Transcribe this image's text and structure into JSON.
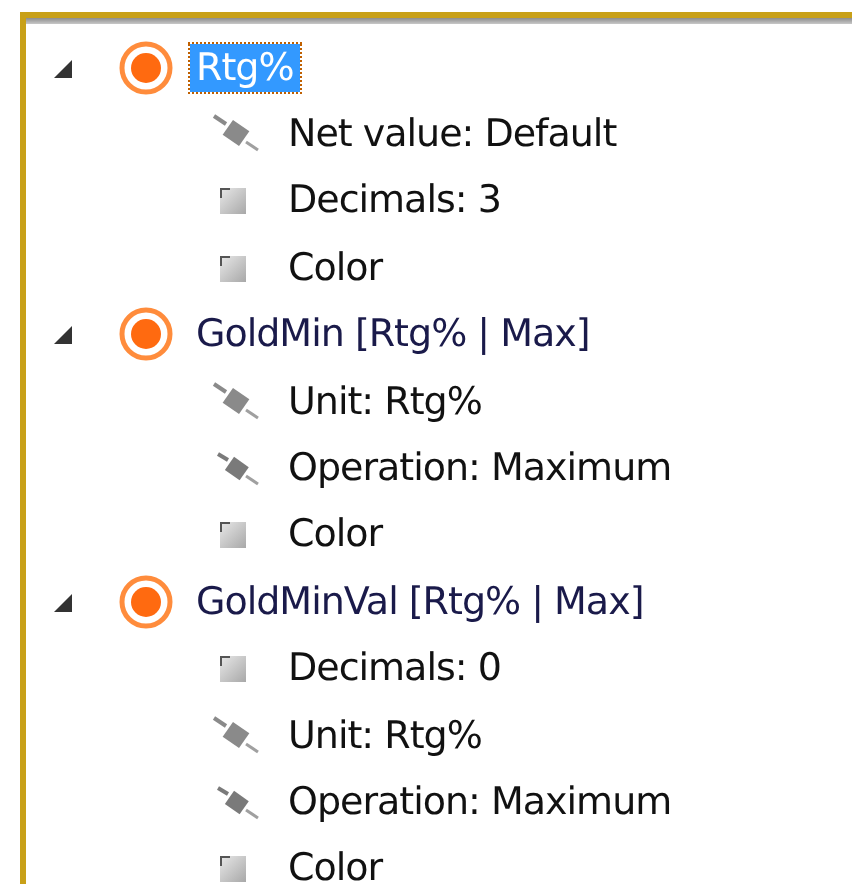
{
  "tree": [
    {
      "label": "Rtg%",
      "selected": true,
      "expanded": true,
      "children": [
        {
          "label": "Net value: Default",
          "kind": "link"
        },
        {
          "label": "Decimals: 3",
          "kind": "setting"
        },
        {
          "label": "Color",
          "kind": "setting"
        }
      ]
    },
    {
      "label": "GoldMin [Rtg% | Max]",
      "selected": false,
      "expanded": true,
      "children": [
        {
          "label": "Unit: Rtg%",
          "kind": "link"
        },
        {
          "label": "Operation: Maximum",
          "kind": "operation"
        },
        {
          "label": "Color",
          "kind": "setting"
        }
      ]
    },
    {
      "label": "GoldMinVal [Rtg% | Max]",
      "selected": false,
      "expanded": true,
      "children": [
        {
          "label": "Decimals: 0",
          "kind": "setting"
        },
        {
          "label": "Unit: Rtg%",
          "kind": "link"
        },
        {
          "label": "Operation: Maximum",
          "kind": "operation"
        },
        {
          "label": "Color",
          "kind": "setting"
        }
      ]
    }
  ]
}
